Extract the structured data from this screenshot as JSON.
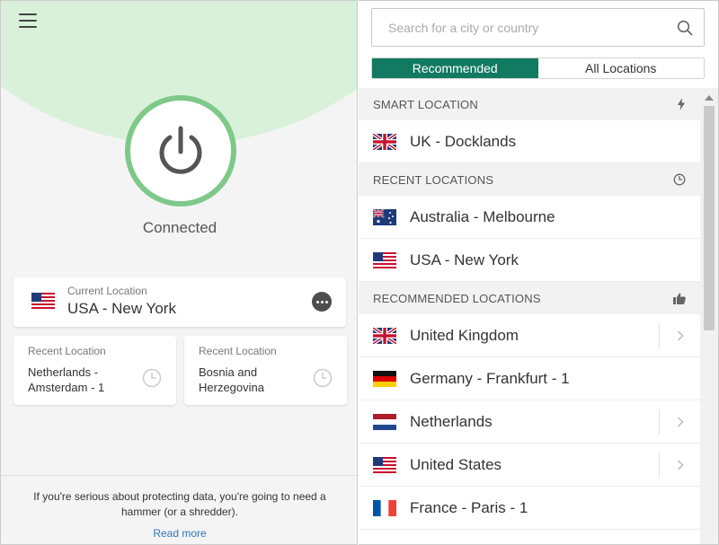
{
  "left": {
    "status": "Connected",
    "current_location": {
      "label": "Current Location",
      "value": "USA - New York",
      "flag": "us-flag"
    },
    "recent_cards": [
      {
        "label": "Recent Location",
        "value": "Netherlands - Amsterdam - 1"
      },
      {
        "label": "Recent Location",
        "value": "Bosnia and Herzegovina"
      }
    ],
    "promo": {
      "text": "If you're serious about protecting data, you're going to need a hammer (or a shredder).",
      "link": "Read more"
    }
  },
  "right": {
    "search": {
      "placeholder": "Search for a city or country",
      "value": ""
    },
    "tabs": [
      {
        "label": "Recommended",
        "active": true
      },
      {
        "label": "All Locations",
        "active": false
      }
    ],
    "sections": [
      {
        "title": "SMART LOCATION",
        "icon": "bolt-icon",
        "items": [
          {
            "name": "UK - Docklands",
            "flag": "uk-flag",
            "chevron": false
          }
        ]
      },
      {
        "title": "RECENT LOCATIONS",
        "icon": "clock-icon",
        "items": [
          {
            "name": "Australia - Melbourne",
            "flag": "au-flag",
            "chevron": false
          },
          {
            "name": "USA - New York",
            "flag": "us-flag",
            "chevron": false
          }
        ]
      },
      {
        "title": "RECOMMENDED LOCATIONS",
        "icon": "thumbs-up-icon",
        "items": [
          {
            "name": "United Kingdom",
            "flag": "uk-flag",
            "chevron": true
          },
          {
            "name": "Germany - Frankfurt - 1",
            "flag": "de-flag",
            "chevron": false
          },
          {
            "name": "Netherlands",
            "flag": "nl-flag",
            "chevron": true
          },
          {
            "name": "United States",
            "flag": "us-flag",
            "chevron": true
          },
          {
            "name": "France - Paris - 1",
            "flag": "fr-flag",
            "chevron": false
          }
        ]
      }
    ]
  },
  "colors": {
    "accent": "#137a62",
    "ring": "#7ec989",
    "arc": "#d9f1d9",
    "link": "#2f76c0"
  }
}
